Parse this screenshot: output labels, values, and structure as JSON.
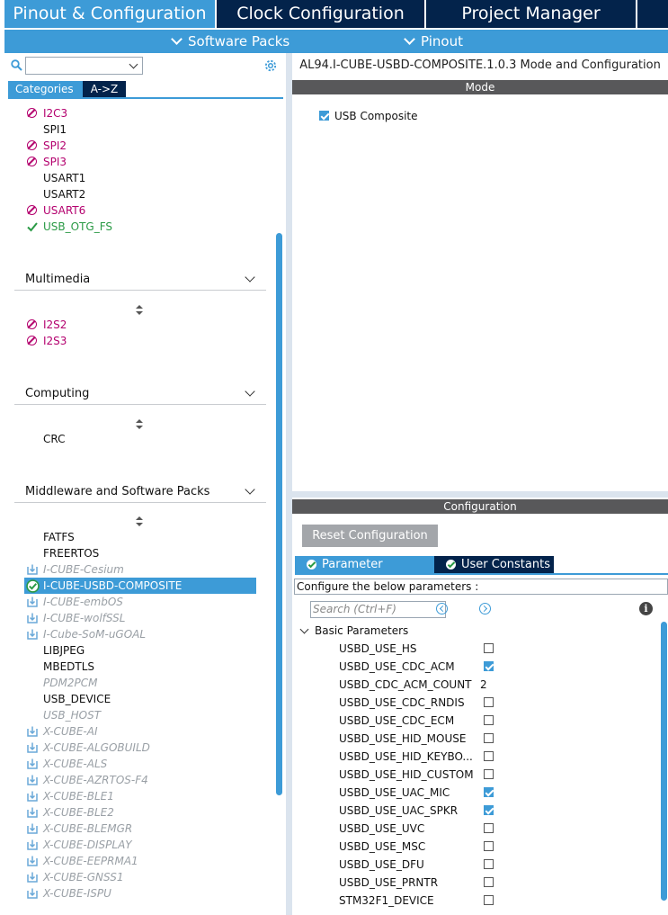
{
  "top_tabs": {
    "pinout": "Pinout & Configuration",
    "clock": "Clock Configuration",
    "project": "Project Manager"
  },
  "sub_menu": {
    "software_packs": "Software Packs",
    "pinout": "Pinout"
  },
  "left": {
    "search_value": "",
    "tab_categories": "Categories",
    "tab_az": "A->Z",
    "connectivity_items": [
      {
        "label": "I2C3",
        "status": "disabled"
      },
      {
        "label": "SPI1",
        "status": "normal"
      },
      {
        "label": "SPI2",
        "status": "disabled"
      },
      {
        "label": "SPI3",
        "status": "disabled"
      },
      {
        "label": "USART1",
        "status": "normal"
      },
      {
        "label": "USART2",
        "status": "normal"
      },
      {
        "label": "USART6",
        "status": "disabled"
      },
      {
        "label": "USB_OTG_FS",
        "status": "ok"
      }
    ],
    "multimedia": {
      "title": "Multimedia",
      "items": [
        {
          "label": "I2S2",
          "status": "disabled"
        },
        {
          "label": "I2S3",
          "status": "disabled"
        }
      ]
    },
    "computing": {
      "title": "Computing",
      "items": [
        {
          "label": "CRC",
          "status": "normal"
        }
      ]
    },
    "middleware": {
      "title": "Middleware and Software Packs",
      "items": [
        {
          "label": "FATFS",
          "status": "normal"
        },
        {
          "label": "FREERTOS",
          "status": "normal"
        },
        {
          "label": "I-CUBE-Cesium",
          "status": "pack"
        },
        {
          "label": "I-CUBE-USBD-COMPOSITE",
          "status": "selected"
        },
        {
          "label": "I-CUBE-embOS",
          "status": "pack"
        },
        {
          "label": "I-CUBE-wolfSSL",
          "status": "pack"
        },
        {
          "label": "I-Cube-SoM-uGOAL",
          "status": "pack"
        },
        {
          "label": "LIBJPEG",
          "status": "normal"
        },
        {
          "label": "MBEDTLS",
          "status": "normal"
        },
        {
          "label": "PDM2PCM",
          "status": "gray"
        },
        {
          "label": "USB_DEVICE",
          "status": "normal"
        },
        {
          "label": "USB_HOST",
          "status": "gray"
        },
        {
          "label": "X-CUBE-AI",
          "status": "pack"
        },
        {
          "label": "X-CUBE-ALGOBUILD",
          "status": "pack"
        },
        {
          "label": "X-CUBE-ALS",
          "status": "pack"
        },
        {
          "label": "X-CUBE-AZRTOS-F4",
          "status": "pack"
        },
        {
          "label": "X-CUBE-BLE1",
          "status": "pack"
        },
        {
          "label": "X-CUBE-BLE2",
          "status": "pack"
        },
        {
          "label": "X-CUBE-BLEMGR",
          "status": "pack"
        },
        {
          "label": "X-CUBE-DISPLAY",
          "status": "pack"
        },
        {
          "label": "X-CUBE-EEPRMA1",
          "status": "pack"
        },
        {
          "label": "X-CUBE-GNSS1",
          "status": "pack"
        },
        {
          "label": "X-CUBE-ISPU",
          "status": "pack"
        }
      ]
    }
  },
  "right": {
    "title": "AL94.I-CUBE-USBD-COMPOSITE.1.0.3 Mode and Configuration",
    "mode_header": "Mode",
    "mode_checkbox_label": "USB Composite",
    "mode_checkbox_checked": true,
    "config_header": "Configuration",
    "reset_button": "Reset Configuration",
    "tab_params": "Parameter Settings",
    "tab_constants": "User Constants",
    "configure_text": "Configure the below parameters :",
    "search_placeholder": "Search (Ctrl+F)",
    "group_label": "Basic Parameters",
    "params": [
      {
        "name": "USBD_USE_HS",
        "kind": "check",
        "checked": false
      },
      {
        "name": "USBD_USE_CDC_ACM",
        "kind": "check",
        "checked": true
      },
      {
        "name": "USBD_CDC_ACM_COUNT",
        "kind": "value",
        "value": "2"
      },
      {
        "name": "USBD_USE_CDC_RNDIS",
        "kind": "check",
        "checked": false
      },
      {
        "name": "USBD_USE_CDC_ECM",
        "kind": "check",
        "checked": false
      },
      {
        "name": "USBD_USE_HID_MOUSE",
        "kind": "check",
        "checked": false
      },
      {
        "name": "USBD_USE_HID_KEYBO...",
        "kind": "check",
        "checked": false
      },
      {
        "name": "USBD_USE_HID_CUSTOM",
        "kind": "check",
        "checked": false
      },
      {
        "name": "USBD_USE_UAC_MIC",
        "kind": "check",
        "checked": true
      },
      {
        "name": "USBD_USE_UAC_SPKR",
        "kind": "check",
        "checked": true
      },
      {
        "name": "USBD_USE_UVC",
        "kind": "check",
        "checked": false
      },
      {
        "name": "USBD_USE_MSC",
        "kind": "check",
        "checked": false
      },
      {
        "name": "USBD_USE_DFU",
        "kind": "check",
        "checked": false
      },
      {
        "name": "USBD_USE_PRNTR",
        "kind": "check",
        "checked": false
      },
      {
        "name": "STM32F1_DEVICE",
        "kind": "check",
        "checked": false
      }
    ]
  },
  "colors": {
    "accent": "#3d9bd7",
    "navy": "#03234b",
    "disabled": "#b4006e",
    "ok": "#2a9a45"
  }
}
